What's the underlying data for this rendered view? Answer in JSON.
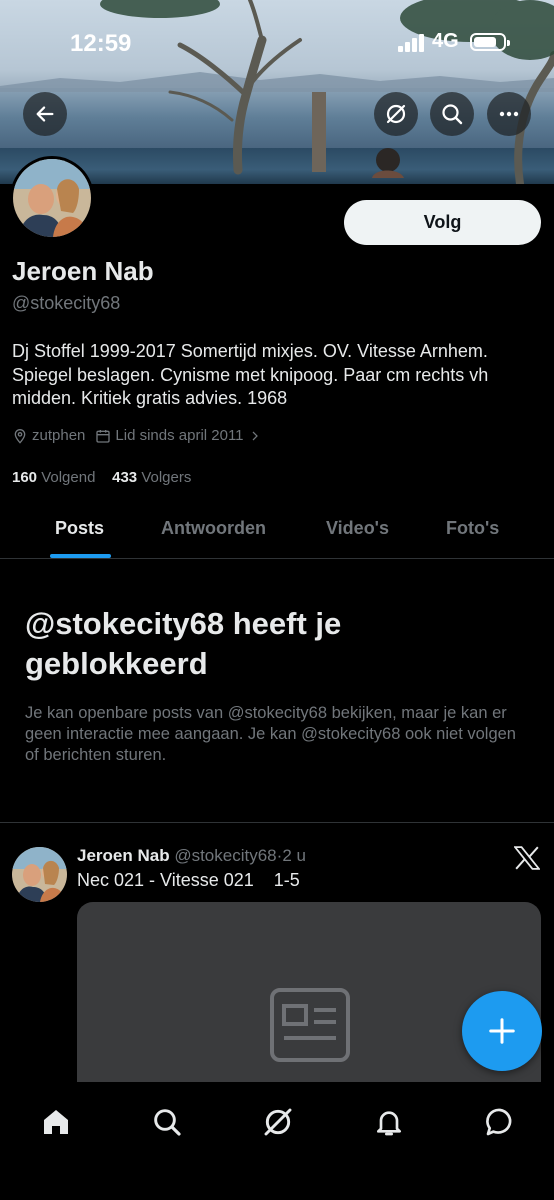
{
  "status_bar": {
    "time": "12:59",
    "network": "4G"
  },
  "profile": {
    "name": "Jeroen Nab",
    "handle": "@stokecity68",
    "follow_label": "Volg",
    "bio": "Dj Stoffel 1999-2017 Somertijd mixjes. OV. Vitesse Arnhem. Spiegel beslagen. Cynisme met knipoog. Paar cm rechts vh midden. Kritiek gratis advies. 1968",
    "location": "zutphen",
    "joined": "Lid sinds april 2011",
    "following_count": "160",
    "following_label": "Volgend",
    "followers_count": "433",
    "followers_label": "Volgers"
  },
  "tabs": [
    {
      "label": "Posts",
      "active": true
    },
    {
      "label": "Antwoorden",
      "active": false
    },
    {
      "label": "Video's",
      "active": false
    },
    {
      "label": "Foto's",
      "active": false
    }
  ],
  "blocked": {
    "title": "@stokecity68 heeft je geblokkeerd",
    "description": "Je kan openbare posts van @stokecity68 bekijken, maar je kan er geen interactie mee aangaan. Je kan @stokecity68 ook niet volgen of berichten sturen."
  },
  "post": {
    "author": "Jeroen Nab",
    "handle": "@stokecity68",
    "separator": "·",
    "time": "2 u",
    "text": "Nec 021 - Vitesse 021    1-5"
  },
  "icons": {
    "back": "back-arrow-icon",
    "grok": "grok-icon",
    "search": "search-icon",
    "more": "more-icon",
    "location": "location-pin-icon",
    "calendar": "calendar-icon",
    "x_logo": "x-logo-icon",
    "article": "article-icon",
    "compose": "plus-icon",
    "nav": [
      "home-icon",
      "search-icon",
      "grok-icon",
      "bell-icon",
      "messages-icon"
    ]
  },
  "colors": {
    "accent": "#1d9bf0",
    "background": "#000000",
    "muted": "#71767b",
    "card": "#3a3b3d"
  }
}
